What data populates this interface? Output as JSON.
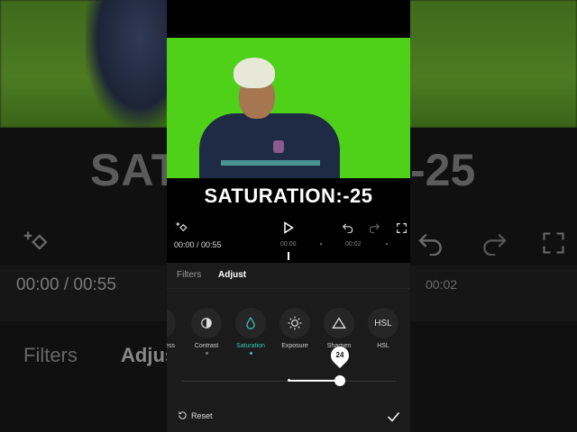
{
  "background": {
    "caption_left": "SAT",
    "caption_right": "-25",
    "time": "00:00 / 00:55",
    "time_mark": "00:02",
    "tab_filters": "Filters",
    "tab_adjust": "Adjus"
  },
  "video": {
    "caption": "SATURATION:-25"
  },
  "toolbar": {
    "icons": [
      "keyframe-icon",
      "play-icon",
      "undo-icon",
      "redo-icon",
      "fullscreen-icon"
    ]
  },
  "timeline": {
    "time": "00:00 / 00:55",
    "mark_1": "00:00",
    "mark_2": "00:02"
  },
  "panel": {
    "tabs": [
      {
        "label": "Filters",
        "active": false
      },
      {
        "label": "Adjust",
        "active": true
      }
    ],
    "tools": [
      {
        "label": "ness",
        "icon": "brightness-icon"
      },
      {
        "label": "Contrast",
        "icon": "contrast-icon"
      },
      {
        "label": "Saturation",
        "icon": "saturation-icon",
        "active": true
      },
      {
        "label": "Exposure",
        "icon": "exposure-icon"
      },
      {
        "label": "Sharpen",
        "icon": "sharpen-icon"
      },
      {
        "label": "HSL",
        "icon": "hsl-icon",
        "icon_text": "HSL"
      }
    ],
    "slider": {
      "value": "24",
      "min": -50,
      "max": 50,
      "current": 24
    },
    "reset_label": "Reset"
  },
  "colors": {
    "accent": "#36c7b0",
    "panel": "#1b1b1b",
    "video_bg": "#4fd11a"
  }
}
